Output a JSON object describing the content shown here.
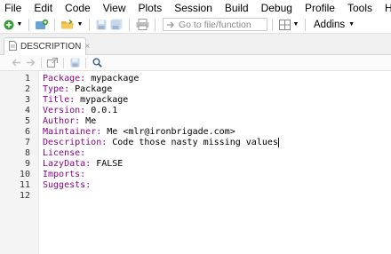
{
  "menubar": {
    "items": [
      "File",
      "Edit",
      "Code",
      "View",
      "Plots",
      "Session",
      "Build",
      "Debug",
      "Profile",
      "Tools",
      "Help"
    ]
  },
  "toolbar": {
    "goto_placeholder": "Go to file/function",
    "addins_label": "Addins"
  },
  "tab": {
    "label": "DESCRIPTION",
    "close": "×"
  },
  "editor": {
    "lines": [
      {
        "number": "1",
        "key": "Package:",
        "value": " mypackage"
      },
      {
        "number": "2",
        "key": "Type:",
        "value": " Package"
      },
      {
        "number": "3",
        "key": "Title:",
        "value": " mypackage"
      },
      {
        "number": "4",
        "key": "Version:",
        "value": " 0.0.1"
      },
      {
        "number": "5",
        "key": "Author:",
        "value": " Me"
      },
      {
        "number": "6",
        "key": "Maintainer:",
        "value": " Me <mlr@ironbrigade.com>"
      },
      {
        "number": "7",
        "key": "Description:",
        "value": " Code those nasty missing values"
      },
      {
        "number": "8",
        "key": "License:",
        "value": ""
      },
      {
        "number": "9",
        "key": "LazyData:",
        "value": " FALSE"
      },
      {
        "number": "10",
        "key": "Imports:",
        "value": ""
      },
      {
        "number": "11",
        "key": "Suggests:",
        "value": ""
      },
      {
        "number": "12",
        "key": "",
        "value": ""
      }
    ]
  },
  "colors": {
    "key": "#8b008b",
    "accent": "#4a8fd6",
    "new_file_green": "#3c9a3c"
  },
  "icons": [
    "new-file-icon",
    "new-project-icon",
    "open-folder-icon",
    "save-icon",
    "save-all-icon",
    "print-icon",
    "goto-arrow-icon",
    "grid-layout-icon",
    "back-arrow-icon",
    "forward-arrow-icon",
    "show-in-window-icon",
    "search-icon",
    "document-icon"
  ]
}
